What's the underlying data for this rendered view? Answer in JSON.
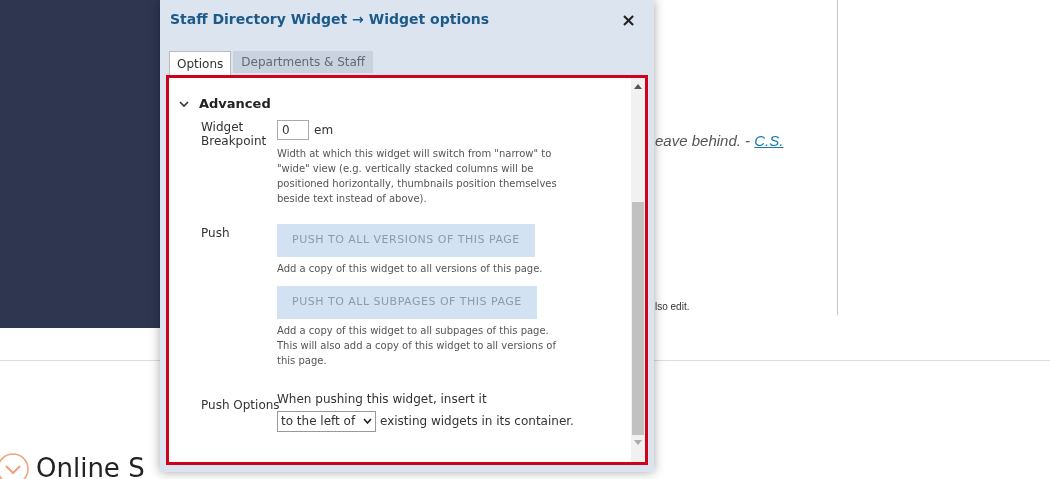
{
  "page": {
    "quote_text": "eave behind. - ",
    "quote_link": "C.S.",
    "note": "lso edit.",
    "section_heading": "Online S"
  },
  "dialog": {
    "title": "Staff Directory Widget → Widget options",
    "close": "×",
    "tabs": [
      {
        "label": "Options",
        "selected": true
      },
      {
        "label": "Departments & Staff",
        "selected": false
      }
    ],
    "section": {
      "title": "Advanced",
      "expanded": true
    },
    "breakpoint": {
      "label": "Widget Breakpoint",
      "value": "0",
      "unit": "em",
      "help": "Width at which this widget will switch from \"narrow\" to \"wide\" view (e.g. vertically stacked columns will be positioned horizontally, thumbnails position themselves beside text instead of above)."
    },
    "push": {
      "label": "Push",
      "buttons": [
        {
          "label": "PUSH TO ALL VERSIONS OF THIS PAGE",
          "disabled": true,
          "help": "Add a copy of this widget to all versions of this page."
        },
        {
          "label": "PUSH TO ALL SUBPAGES OF THIS PAGE",
          "disabled": true,
          "help": "Add a copy of this widget to all subpages of this page. This will also add a copy of this widget to all versions of this page."
        }
      ]
    },
    "push_options": {
      "label": "Push Options",
      "intro": "When pushing this widget, insert it",
      "select_value": "to the left of",
      "suffix": "existing widgets in its container."
    }
  }
}
